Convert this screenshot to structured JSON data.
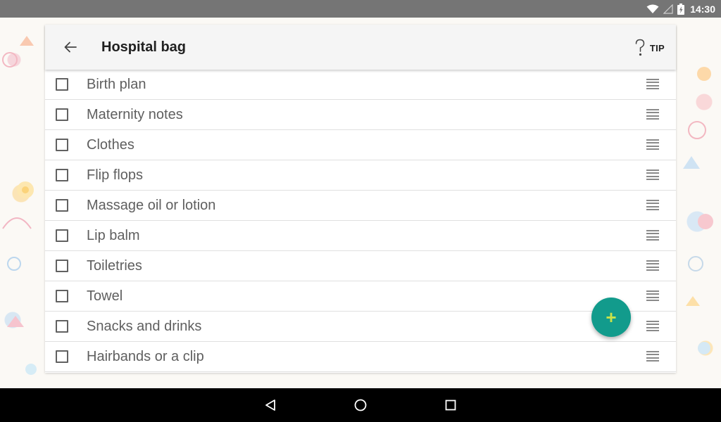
{
  "status_bar": {
    "time": "14:30",
    "icons": [
      "wifi-icon",
      "signal-icon",
      "battery-icon"
    ]
  },
  "toolbar": {
    "title": "Hospital bag",
    "back_icon": "arrow-left-icon",
    "tip_icon": "question-icon",
    "tip_label": "TIP"
  },
  "items": [
    {
      "label": "Birth plan",
      "checked": false
    },
    {
      "label": "Maternity notes",
      "checked": false
    },
    {
      "label": "Clothes",
      "checked": false
    },
    {
      "label": "Flip flops",
      "checked": false
    },
    {
      "label": "Massage oil or lotion",
      "checked": false
    },
    {
      "label": "Lip balm",
      "checked": false
    },
    {
      "label": "Toiletries",
      "checked": false
    },
    {
      "label": "Towel",
      "checked": false
    },
    {
      "label": "Snacks and drinks",
      "checked": false
    },
    {
      "label": "Hairbands or a clip",
      "checked": false
    }
  ],
  "fab": {
    "label": "+",
    "color": "#129b8c"
  },
  "nav": {
    "icons": [
      "back-triangle-icon",
      "home-circle-icon",
      "recents-square-icon"
    ]
  }
}
